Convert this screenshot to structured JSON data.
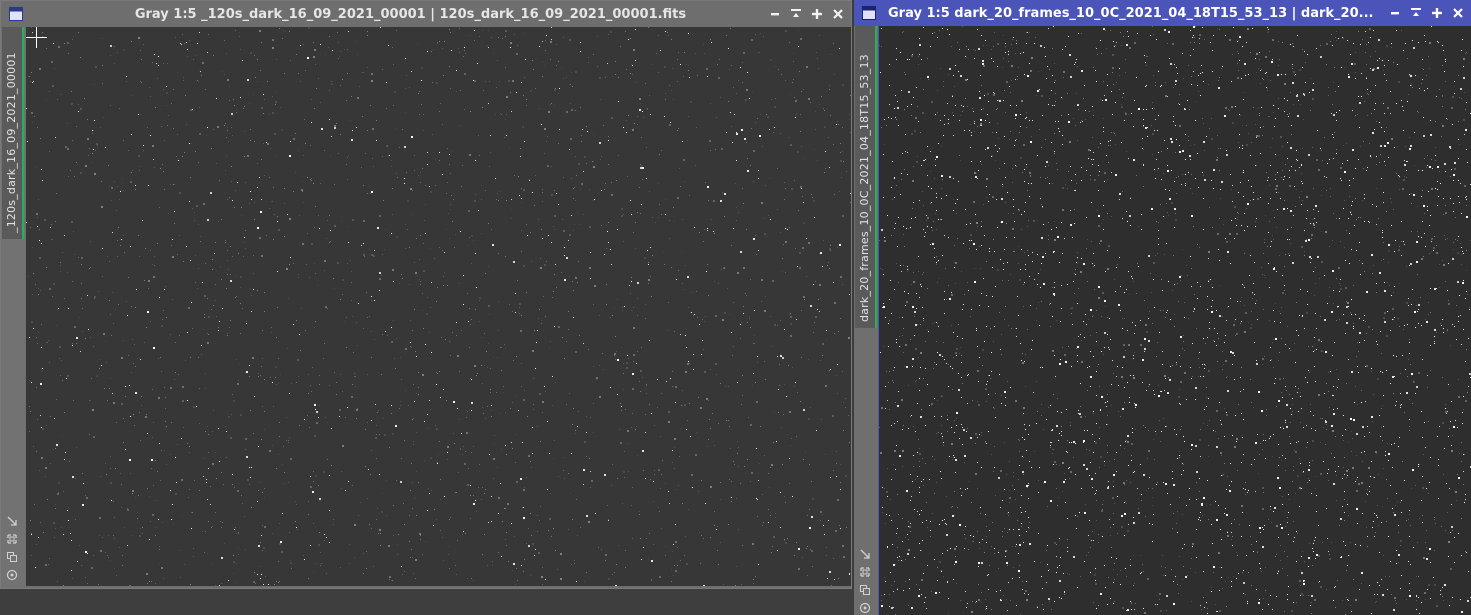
{
  "windows": [
    {
      "title": "Gray 1:5 _120s_dark_16_09_2021_00001 | 120s_dark_16_09_2021_00001.fits",
      "tab_label": "_120s_dark_16_09_2021_00001",
      "active": false
    },
    {
      "title": "Gray 1:5 dark_20_frames_10_0C_2021_04_18T15_53_13 | dark_20...",
      "tab_label": "dark_20_frames_10_0C_2021_04_18T15_53_13",
      "active": true
    }
  ],
  "icons": {
    "window": "window-icon",
    "minimize": "minimize-icon",
    "shade": "shade-icon",
    "maximize": "maximize-icon",
    "close": "close-icon",
    "side": [
      "fit-view-icon",
      "zoom-fit-icon",
      "clone-icon",
      "target-icon"
    ]
  },
  "colors": {
    "inactive_titlebar": "#6e6e6e",
    "active_titlebar": "#4b54b8",
    "tab_accent": "#22b35a"
  }
}
